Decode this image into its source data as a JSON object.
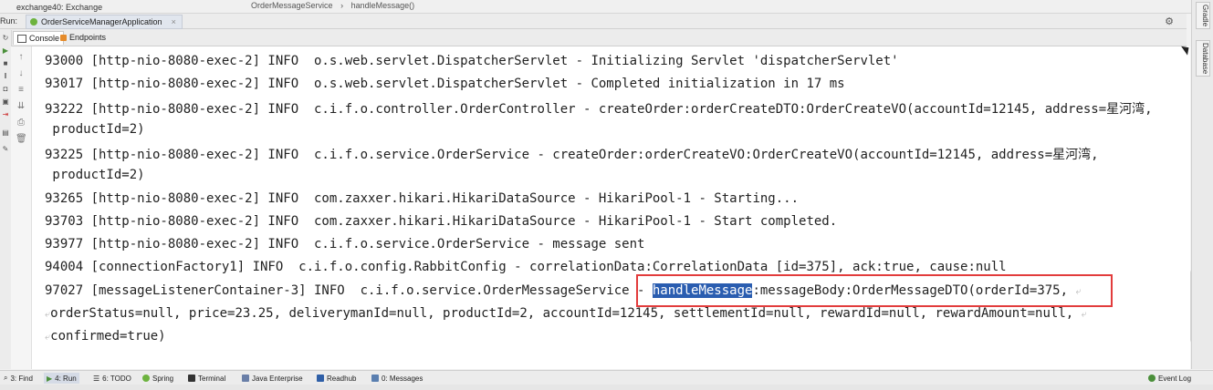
{
  "header": {
    "exchange_text": "exchange40: Exchange",
    "breadcrumb": [
      "OrderMessageService",
      "handleMessage()"
    ],
    "breadcrumb_sep": "›"
  },
  "run_bar": {
    "label": "Run:",
    "app_tab": "OrderServiceManagerApplication",
    "close_glyph": "×",
    "gear_glyph": "⚙"
  },
  "console_tabs": [
    {
      "label": "Console",
      "active": true
    },
    {
      "label": "Endpoints",
      "active": false
    }
  ],
  "right_tabs": [
    "Gradle",
    "Database"
  ],
  "console": {
    "highlight_word": "handleMessage",
    "wrap_glyph": "⤶",
    "lines": [
      {
        "text": "93000 [http-nio-8080-exec-2] INFO  o.s.web.servlet.DispatcherServlet - Initializing Servlet 'dispatcherServlet'"
      },
      {
        "text": "93017 [http-nio-8080-exec-2] INFO  o.s.web.servlet.DispatcherServlet - Completed initialization in 17 ms"
      },
      {
        "text": "93222 [http-nio-8080-exec-2] INFO  c.i.f.o.controller.OrderController - createOrder:orderCreateDTO:OrderCreateVO(accountId=12145, address=星河湾,"
      },
      {
        "text": " productId=2)"
      },
      {
        "text": "93225 [http-nio-8080-exec-2] INFO  c.i.f.o.service.OrderService - createOrder:orderCreateVO:OrderCreateVO(accountId=12145, address=星河湾,"
      },
      {
        "text": " productId=2)"
      },
      {
        "text": "93265 [http-nio-8080-exec-2] INFO  com.zaxxer.hikari.HikariDataSource - HikariPool-1 - Starting..."
      },
      {
        "text": "93703 [http-nio-8080-exec-2] INFO  com.zaxxer.hikari.HikariDataSource - HikariPool-1 - Start completed."
      },
      {
        "text": "93977 [http-nio-8080-exec-2] INFO  c.i.f.o.service.OrderService - message sent"
      },
      {
        "text": "94004 [connectionFactory1] INFO  c.i.f.o.config.RabbitConfig - correlationData:CorrelationData [id=375], ack:true, cause:null"
      },
      {
        "pre": "97027 [messageListenerContainer-3] INFO  c.i.f.o.service.OrderMessageService - ",
        "post": ":messageBody:OrderMessageDTO(orderId=375, "
      },
      {
        "text": "orderStatus=null, price=23.25, deliverymanId=null, productId=2, accountId=12145, settlementId=null, rewardId=null, rewardAmount=null, "
      },
      {
        "text": "confirmed=true)"
      }
    ]
  },
  "bottom_tabs": [
    {
      "label": "3: Find",
      "active": false
    },
    {
      "label": "4: Run",
      "active": true
    },
    {
      "label": "6: TODO",
      "active": false
    },
    {
      "label": "Spring",
      "active": false
    },
    {
      "label": "Terminal",
      "active": false
    },
    {
      "label": "Java Enterprise",
      "active": false
    },
    {
      "label": "Readhub",
      "active": false
    },
    {
      "label": "0: Messages",
      "active": false
    },
    {
      "label": "Event Log",
      "active": false
    }
  ],
  "colors": {
    "highlight": "#2a5db0",
    "annotation_box": "#e23c3c"
  }
}
